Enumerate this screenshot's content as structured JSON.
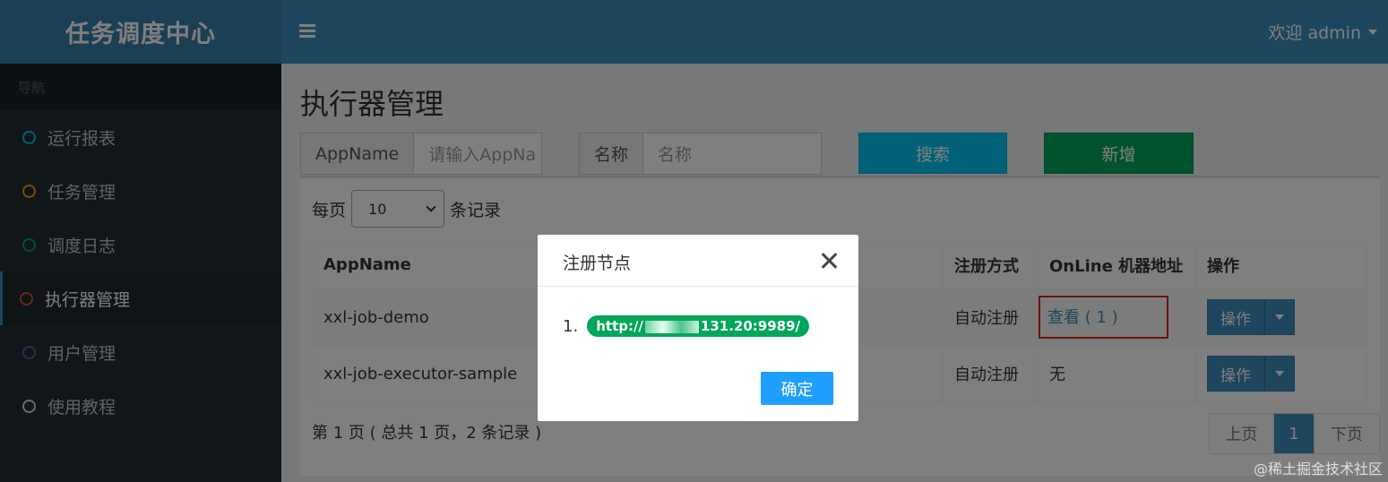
{
  "header": {
    "logo": "任务调度中心",
    "user": "欢迎 admin"
  },
  "sidebar": {
    "section": "导航",
    "items": [
      {
        "label": "运行报表",
        "color": "#00c0ef"
      },
      {
        "label": "任务管理",
        "color": "#f39c12"
      },
      {
        "label": "调度日志",
        "color": "#00a65a"
      },
      {
        "label": "执行器管理",
        "color": "#dd4b39"
      },
      {
        "label": "用户管理",
        "color": "#605ca8"
      },
      {
        "label": "使用教程",
        "color": "#d2d6de"
      }
    ]
  },
  "main": {
    "title": "执行器管理",
    "filters": {
      "appname_label": "AppName",
      "appname_placeholder": "请输入AppNa",
      "name_label": "名称",
      "name_placeholder": "名称"
    },
    "search_btn": "搜索",
    "add_btn": "新增",
    "length": {
      "prefix": "每页",
      "value": "10",
      "suffix": "条记录"
    },
    "table": {
      "headers": [
        "AppName",
        "注册方式",
        "OnLine 机器地址",
        "操作"
      ],
      "rows": [
        {
          "appname": "xxl-job-demo",
          "type": "自动注册",
          "online": "查看 ( 1 )",
          "op": "操作"
        },
        {
          "appname": "xxl-job-executor-sample",
          "type": "自动注册",
          "online": "无",
          "op": "操作"
        }
      ]
    },
    "info": "第 1 页 ( 总共 1 页，2 条记录 )",
    "pager": {
      "prev": "上页",
      "current": "1",
      "next": "下页"
    }
  },
  "modal": {
    "title": "注册节点",
    "index": "1.",
    "node_prefix": "http://",
    "node_suffix": "131.20:9989/",
    "ok": "确定"
  },
  "watermark": "@稀土掘金技术社区"
}
